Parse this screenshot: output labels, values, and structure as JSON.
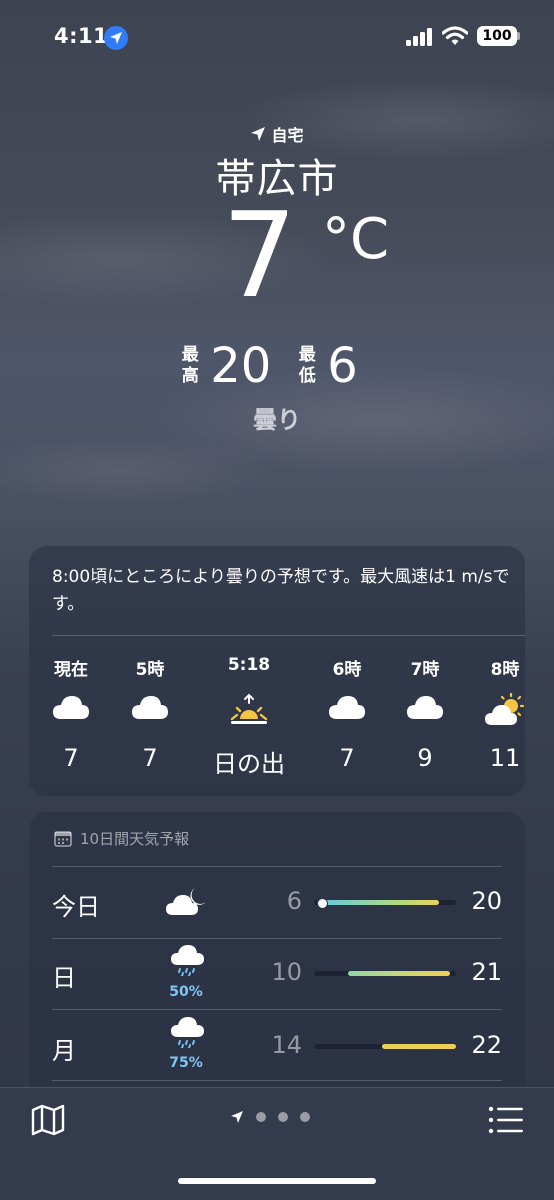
{
  "status_bar": {
    "time": "4:11",
    "battery": "100"
  },
  "header": {
    "location_label": "自宅",
    "city": "帯広市",
    "temperature": "7",
    "unit": "°C",
    "high_label": "最高",
    "high_value": "20",
    "low_label": "最低",
    "low_value": "6",
    "condition": "曇り"
  },
  "hourly": {
    "summary": "8:00頃にところにより曇りの予想です。最大風速は1 m/sです。",
    "items": [
      {
        "label": "現在",
        "icon": "cloud-icon",
        "value": "7"
      },
      {
        "label": "5時",
        "icon": "cloud-icon",
        "value": "7"
      },
      {
        "label": "5:18",
        "icon": "sunrise-icon",
        "value": "日の出"
      },
      {
        "label": "6時",
        "icon": "cloud-icon",
        "value": "7"
      },
      {
        "label": "7時",
        "icon": "cloud-icon",
        "value": "9"
      },
      {
        "label": "8時",
        "icon": "partly-sunny-icon",
        "value": "11"
      }
    ]
  },
  "daily": {
    "header": "10日間天気予報",
    "days": [
      {
        "label": "今日",
        "icon": "cloud-moon-icon",
        "precip": "",
        "low": "6",
        "high": "20",
        "range_start": 0.05,
        "range_end": 0.9,
        "current": 0.05
      },
      {
        "label": "日",
        "icon": "rain-cloud-icon",
        "precip": "50%",
        "low": "10",
        "high": "21",
        "range_start": 0.24,
        "range_end": 0.96
      },
      {
        "label": "月",
        "icon": "rain-cloud-icon",
        "precip": "75%",
        "low": "14",
        "high": "22",
        "range_start": 0.48,
        "range_end": 1.0
      }
    ],
    "colors": {
      "today": "#6fd0e0",
      "mid": "#a8d98a",
      "warm": "#f0cf55"
    }
  },
  "bottom_bar": {
    "map_icon": "map-icon",
    "list_icon": "list-icon"
  }
}
